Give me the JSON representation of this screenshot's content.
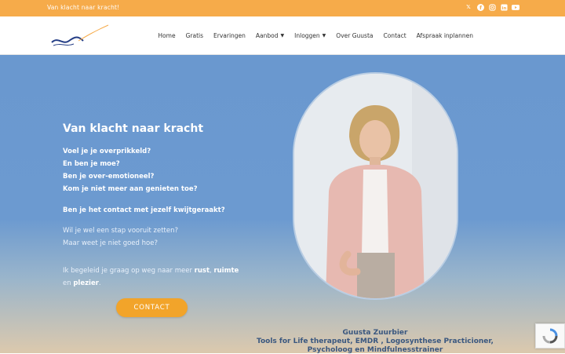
{
  "topbar": {
    "tagline": "Van klacht naar kracht!",
    "social": [
      "x-icon",
      "facebook-icon",
      "instagram-icon",
      "linkedin-icon",
      "youtube-icon"
    ]
  },
  "nav": {
    "home": "Home",
    "gratis": "Gratis",
    "ervaringen": "Ervaringen",
    "aanbod": "Aanbod",
    "inloggen": "Inloggen",
    "over": "Over Guusta",
    "contact": "Contact",
    "afspraak": "Afspraak inplannen"
  },
  "hero": {
    "title": "Van klacht naar kracht",
    "questions": [
      "Voel je je overprikkeld?",
      "En ben je moe?",
      "Ben je over-emotioneel?",
      "Kom je niet meer aan genieten toe?"
    ],
    "contact_question": "Ben je het contact met jezelf kwijtgeraakt?",
    "step_line_1": "Wil je wel een stap vooruit zetten?",
    "step_line_2": "Maar weet je niet goed hoe?",
    "guide_prefix": "Ik begeleid je graag op weg naar meer ",
    "rust": "rust",
    "comma": ", ",
    "ruimte": "ruimte",
    "en": " en",
    "plezier": "plezier",
    "dot": ".",
    "cta_label": "CONTACT"
  },
  "caption": {
    "name": "Guusta Zuurbier",
    "line2": "Tools for Life therapeut, EMDR , Logosynthese Practicioner,",
    "line3": "Psycholoog en Mindfulnesstrainer"
  },
  "colors": {
    "topbar": "#f6ab4a",
    "hero_blue": "#6a98cf",
    "cta": "#f2a42a"
  }
}
